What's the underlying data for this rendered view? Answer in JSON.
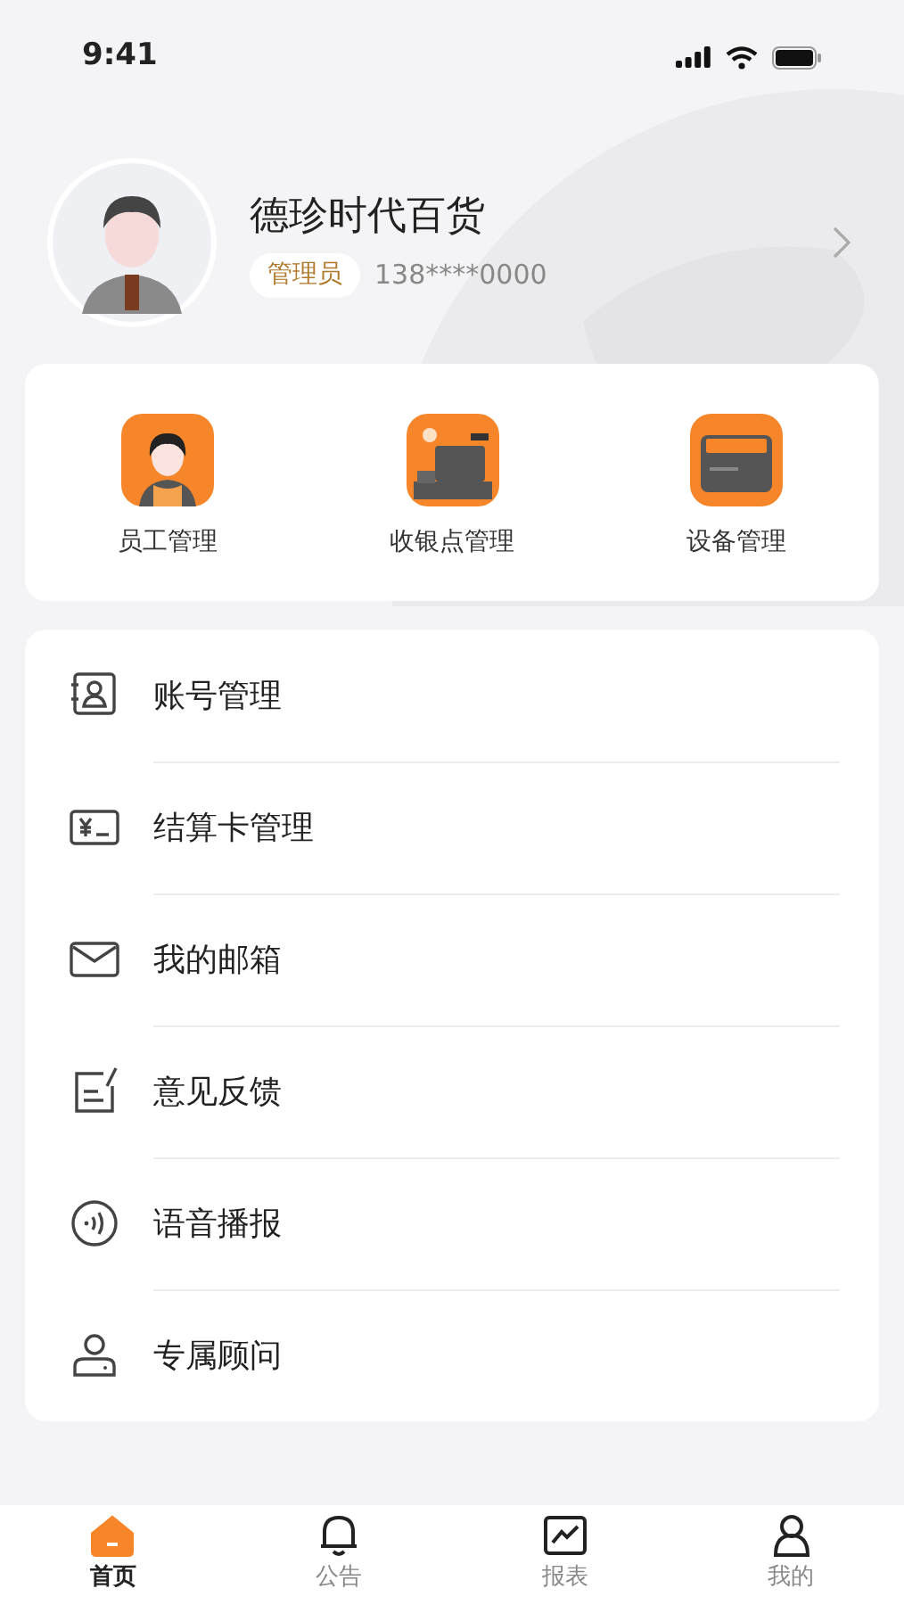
{
  "status_bar": {
    "time": "9:41"
  },
  "profile": {
    "name": "德珍时代百货",
    "role": "管理员",
    "phone": "138****0000"
  },
  "quick_actions": [
    {
      "kind": "staff",
      "label": "员工管理"
    },
    {
      "kind": "register",
      "label": "收银点管理"
    },
    {
      "kind": "device",
      "label": "设备管理"
    }
  ],
  "menu": [
    {
      "kind": "account",
      "label": "账号管理"
    },
    {
      "kind": "card",
      "label": "结算卡管理"
    },
    {
      "kind": "mail",
      "label": "我的邮箱"
    },
    {
      "kind": "feedback",
      "label": "意见反馈"
    },
    {
      "kind": "voice",
      "label": "语音播报"
    },
    {
      "kind": "advisor",
      "label": "专属顾问"
    }
  ],
  "tab_bar": [
    {
      "kind": "home",
      "label": "首页",
      "selected": true
    },
    {
      "kind": "bell",
      "label": "公告",
      "selected": false
    },
    {
      "kind": "chart",
      "label": "报表",
      "selected": false
    },
    {
      "kind": "user",
      "label": "我的",
      "selected": false
    }
  ]
}
